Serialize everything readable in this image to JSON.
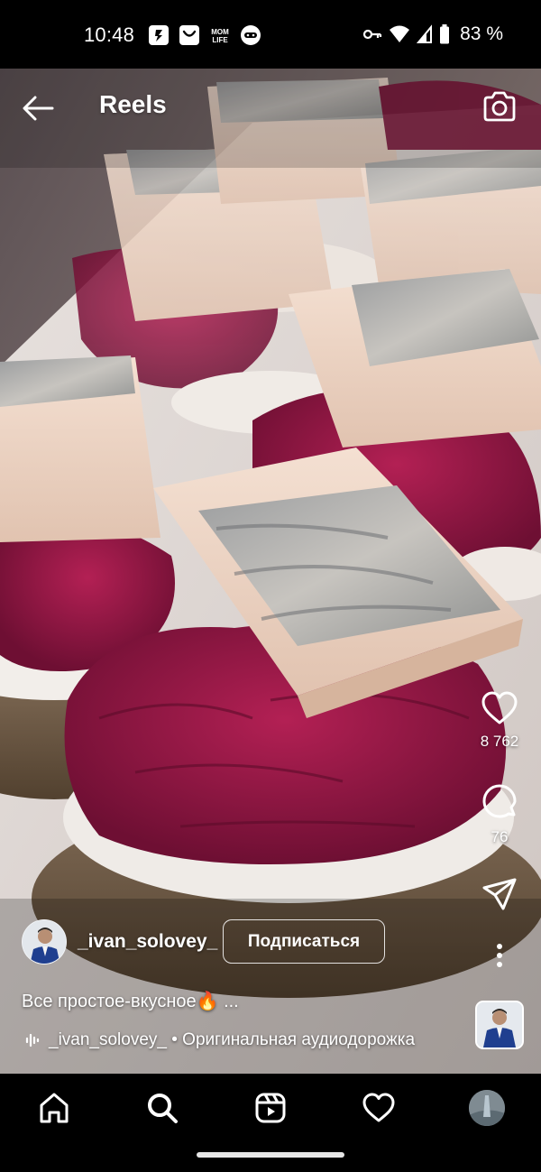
{
  "status_bar": {
    "time": "10:48",
    "app_icons": [
      "app-notification-icon",
      "shopping-bag-icon",
      "mom-life-icon",
      "gamepad-icon"
    ],
    "mom_life_label": "MOM\nLIFE",
    "system_icons": [
      "key-icon",
      "wifi-icon",
      "cell-signal-icon",
      "battery-icon"
    ],
    "battery": "83 %"
  },
  "header": {
    "back_icon": "arrow-left-icon",
    "title": "Reels",
    "camera_icon": "camera-icon"
  },
  "actions": {
    "likes": {
      "icon": "heart-icon",
      "count": "8 762"
    },
    "comments": {
      "icon": "comment-bubble-icon",
      "count": "76"
    },
    "share": {
      "icon": "send-icon"
    },
    "more": {
      "icon": "more-vertical-icon"
    }
  },
  "reel": {
    "username": "_ivan_solovey_",
    "follow_label": "Подписаться",
    "caption": "Все простое-вкусное🔥 ...",
    "audio_icon": "audio-wave-icon",
    "audio_text": "_ivan_solovey_ • Оригинальная аудиодорожка"
  },
  "bottom_nav": {
    "items": [
      "home-icon",
      "search-icon",
      "reels-icon",
      "heart-icon",
      "profile-avatar"
    ],
    "active": "search-icon"
  }
}
